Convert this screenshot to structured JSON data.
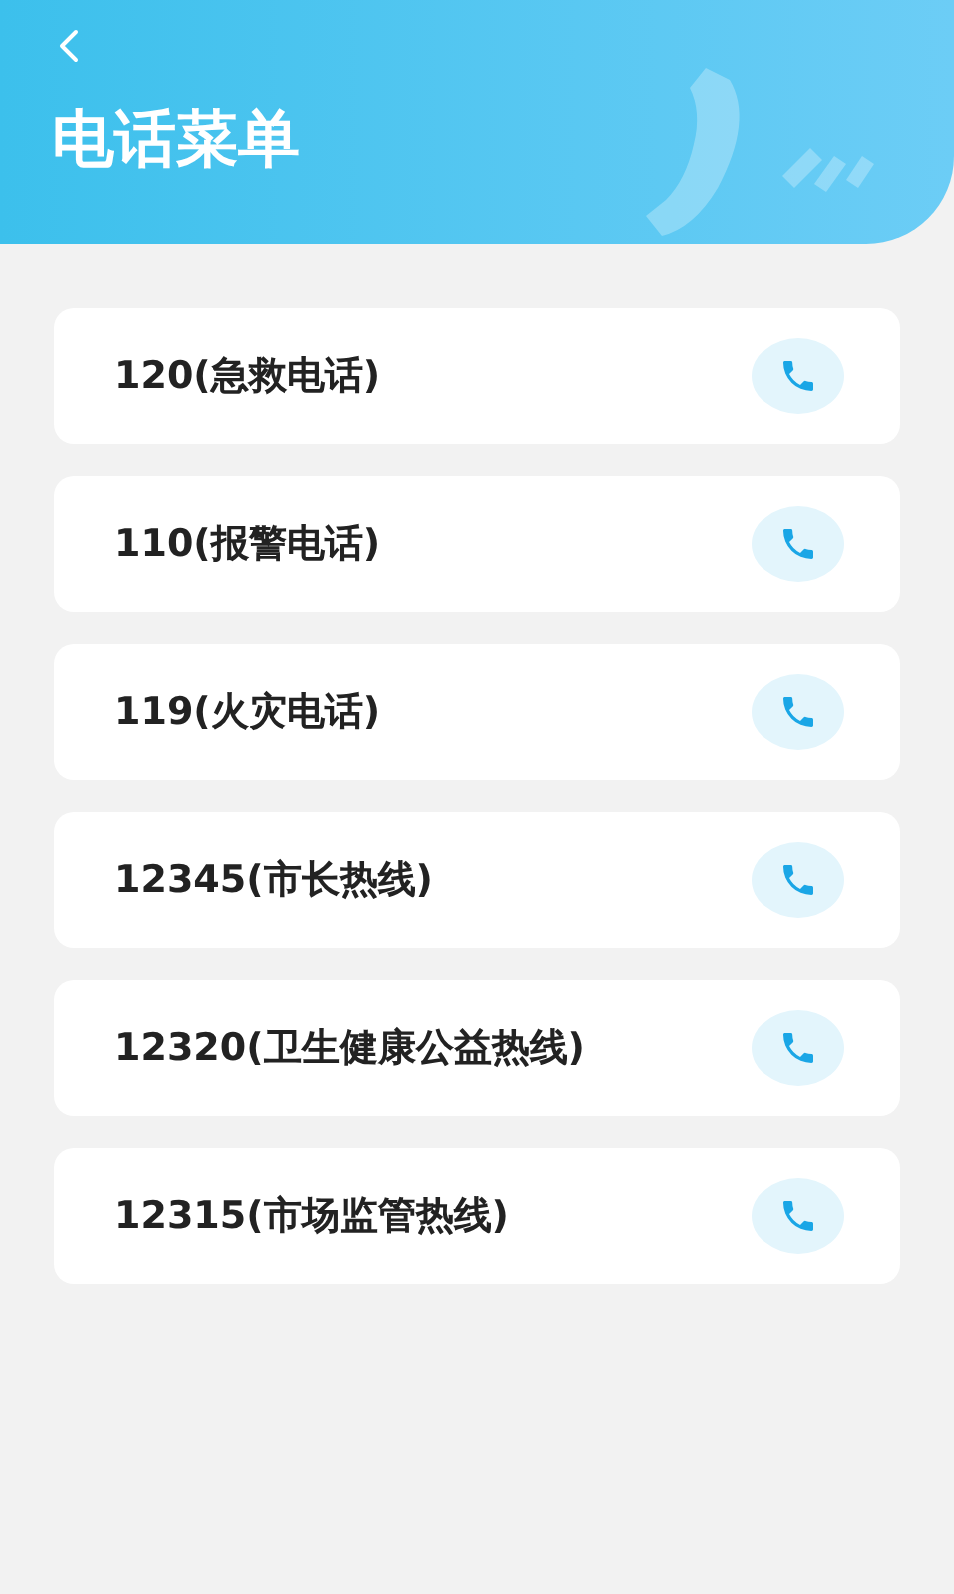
{
  "header": {
    "title": "电话菜单"
  },
  "contacts": [
    {
      "label": "120(急救电话)"
    },
    {
      "label": "110(报警电话)"
    },
    {
      "label": "119(火灾电话)"
    },
    {
      "label": "12345(市长热线)"
    },
    {
      "label": "12320(卫生健康公益热线)"
    },
    {
      "label": "12315(市场监管热线)"
    }
  ]
}
